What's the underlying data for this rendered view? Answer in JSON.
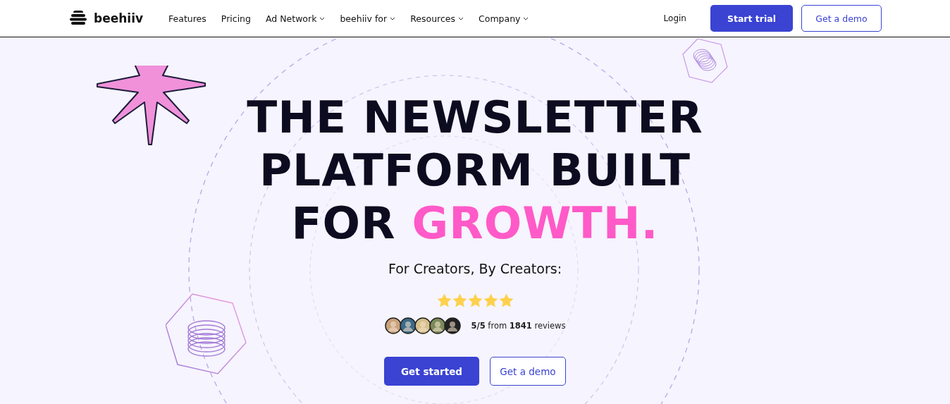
{
  "nav": {
    "brand": "beehiiv",
    "links": [
      {
        "label": "Features",
        "dropdown": false
      },
      {
        "label": "Pricing",
        "dropdown": false
      },
      {
        "label": "Ad Network",
        "dropdown": true
      },
      {
        "label": "beehiiv for",
        "dropdown": true
      },
      {
        "label": "Resources",
        "dropdown": true
      },
      {
        "label": "Company",
        "dropdown": true
      }
    ],
    "login": "Login",
    "primary": "Start trial",
    "secondary": "Get a demo"
  },
  "hero": {
    "headline": "THE NEWSLETTER PLATFORM BUILT FOR",
    "highlight": "GROWTH.",
    "subtitle": "For Creators, By Creators:",
    "stars": 5,
    "reviews": "**5/5** from **1841** reviews",
    "primary": "Get started",
    "secondary": "Get a demo"
  }
}
